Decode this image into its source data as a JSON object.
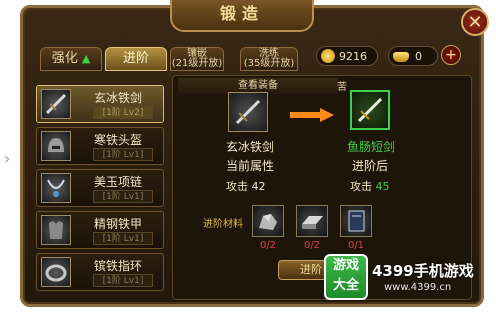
{
  "window": {
    "title": "锻造",
    "close": "✕"
  },
  "tabs": [
    {
      "label": "强化",
      "active": false
    },
    {
      "label": "进阶",
      "active": true
    },
    {
      "label": "镶嵌",
      "sub": "(21级开放)"
    },
    {
      "label": "洗练",
      "sub": "(35级开放)"
    }
  ],
  "resources": {
    "gold": "9216",
    "ingot": "0",
    "add": "+"
  },
  "equipment_list": [
    {
      "name": "玄冰铁剑",
      "level": "[1阶 Lv2]",
      "selected": true,
      "icon": "sword-icon"
    },
    {
      "name": "寒铁头盔",
      "level": "[1阶 Lv1]",
      "selected": false,
      "icon": "helmet-icon"
    },
    {
      "name": "美玉项链",
      "level": "[1阶 Lv1]",
      "selected": false,
      "icon": "necklace-icon"
    },
    {
      "name": "精钢铁甲",
      "level": "[1阶 Lv1]",
      "selected": false,
      "icon": "armor-icon"
    },
    {
      "name": "镔铁指环",
      "level": "[1阶 Lv1]",
      "selected": false,
      "icon": "ring-icon"
    }
  ],
  "detail": {
    "view_equipment": "查看装备",
    "partial_label": "苦",
    "current_item": "玄冰铁剑",
    "next_item": "鱼肠短剑",
    "current_attr_title": "当前属性",
    "next_attr_title": "进阶后",
    "current_attr": {
      "label": "攻击",
      "value": "42"
    },
    "next_attr": {
      "label": "攻击",
      "value": "45"
    },
    "materials_title": "进阶材料",
    "materials": [
      {
        "icon": "ore-icon",
        "count": "0/2"
      },
      {
        "icon": "iron-bar-icon",
        "count": "0/2"
      },
      {
        "icon": "scroll-book-icon",
        "count": "0/1"
      }
    ],
    "action_button": "进阶"
  },
  "watermark": {
    "badge_line1": "游戏",
    "badge_line2": "大全",
    "title": "4399手机游戏",
    "url": "www.4399.cn"
  },
  "colors": {
    "accent_gold": "#d9bc72",
    "next_value_green": "#3fcf4a",
    "material_short_red": "#e04040",
    "arrow_orange": "#ff8a1a"
  }
}
